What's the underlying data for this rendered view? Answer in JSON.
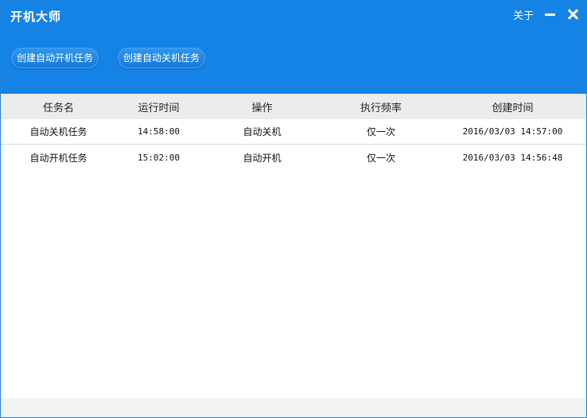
{
  "window": {
    "title": "开机大师",
    "about_label": "关于"
  },
  "toolbar": {
    "create_poweron_label": "创建自动开机任务",
    "create_shutdown_label": "创建自动关机任务"
  },
  "table": {
    "columns": [
      "任务名",
      "运行时间",
      "操作",
      "执行频率",
      "创建时间"
    ],
    "rows": [
      [
        "自动关机任务",
        "14:58:00",
        "自动关机",
        "仅一次",
        "2016/03/03 14:57:00"
      ],
      [
        "自动开机任务",
        "15:02:00",
        "自动开机",
        "仅一次",
        "2016/03/03 14:56:48"
      ]
    ]
  },
  "colors": {
    "header_bg": "#1583e6",
    "table_header_bg": "#ececec"
  }
}
